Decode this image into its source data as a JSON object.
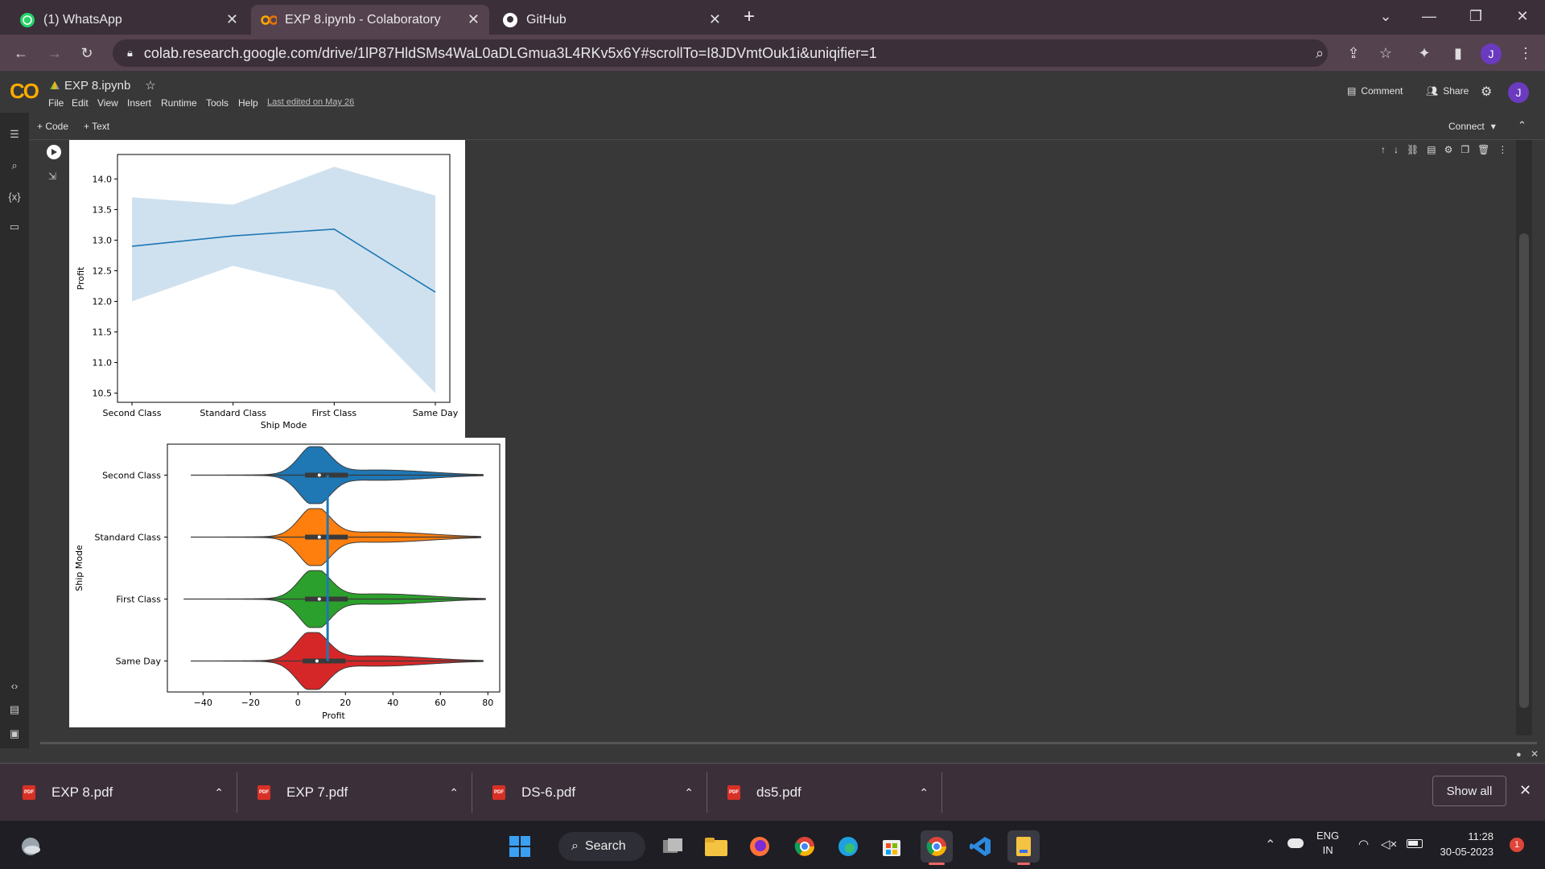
{
  "browser": {
    "tabs": [
      {
        "label": "(1) WhatsApp",
        "icon": "whatsapp-icon"
      },
      {
        "label": "EXP 8.ipynb - Colaboratory",
        "icon": "colab-icon"
      },
      {
        "label": "GitHub",
        "icon": "github-icon"
      }
    ],
    "url": "colab.research.google.com/drive/1lP87HldSMs4WaL0aDLGmua3L4RKv5x6Y#scrollTo=I8JDVmtOuk1i&uniqifier=1",
    "profile_initial": "J"
  },
  "colab": {
    "logo": "CO",
    "notebook_title": "EXP 8.ipynb",
    "menu": [
      "File",
      "Edit",
      "View",
      "Insert",
      "Runtime",
      "Tools",
      "Help"
    ],
    "last_edited": "Last edited on May 26",
    "comment_label": "Comment",
    "share_label": "Share",
    "avatar_initial": "J",
    "add_code_label": "+ Code",
    "add_text_label": "+ Text",
    "connect_label": "Connect"
  },
  "chart_data": [
    {
      "type": "line",
      "title": "",
      "xlabel": "Ship Mode",
      "ylabel": "Profit",
      "categories": [
        "Second Class",
        "Standard Class",
        "First Class",
        "Same Day"
      ],
      "series": [
        {
          "values": [
            12.9,
            13.07,
            13.18,
            12.15
          ],
          "ci_low": [
            12.0,
            12.58,
            12.18,
            10.5
          ],
          "ci_high": [
            13.7,
            13.58,
            14.2,
            13.73
          ]
        }
      ],
      "yticks": [
        10.5,
        11.0,
        11.5,
        12.0,
        12.5,
        13.0,
        13.5,
        14.0
      ],
      "ylim": [
        10.35,
        14.4
      ],
      "color": "#1f77b4",
      "band_color": "#cfe1ef"
    },
    {
      "type": "violin",
      "xlabel": "Profit",
      "ylabel": "Ship Mode",
      "categories": [
        "Second Class",
        "Standard Class",
        "First Class",
        "Same Day"
      ],
      "colors": [
        "#1f77b4",
        "#ff7f0e",
        "#2ca02c",
        "#d62728"
      ],
      "xticks": [
        -40,
        -20,
        0,
        20,
        40,
        60,
        80
      ],
      "xlim": [
        -55,
        85
      ],
      "range": [
        [
          -45,
          78
        ],
        [
          -45,
          77
        ],
        [
          -48,
          79
        ],
        [
          -45,
          78
        ]
      ],
      "median": [
        9,
        9,
        9,
        8
      ],
      "mean_line_x": 12.5
    }
  ],
  "downloads": [
    {
      "name": "EXP 8.pdf"
    },
    {
      "name": "EXP 7.pdf"
    },
    {
      "name": "DS-6.pdf"
    },
    {
      "name": "ds5.pdf"
    }
  ],
  "downloads_show_all": "Show all",
  "taskbar": {
    "search_label": "Search",
    "lang_line1": "ENG",
    "lang_line2": "IN",
    "time": "11:28",
    "date": "30-05-2023",
    "notification_count": "1"
  }
}
